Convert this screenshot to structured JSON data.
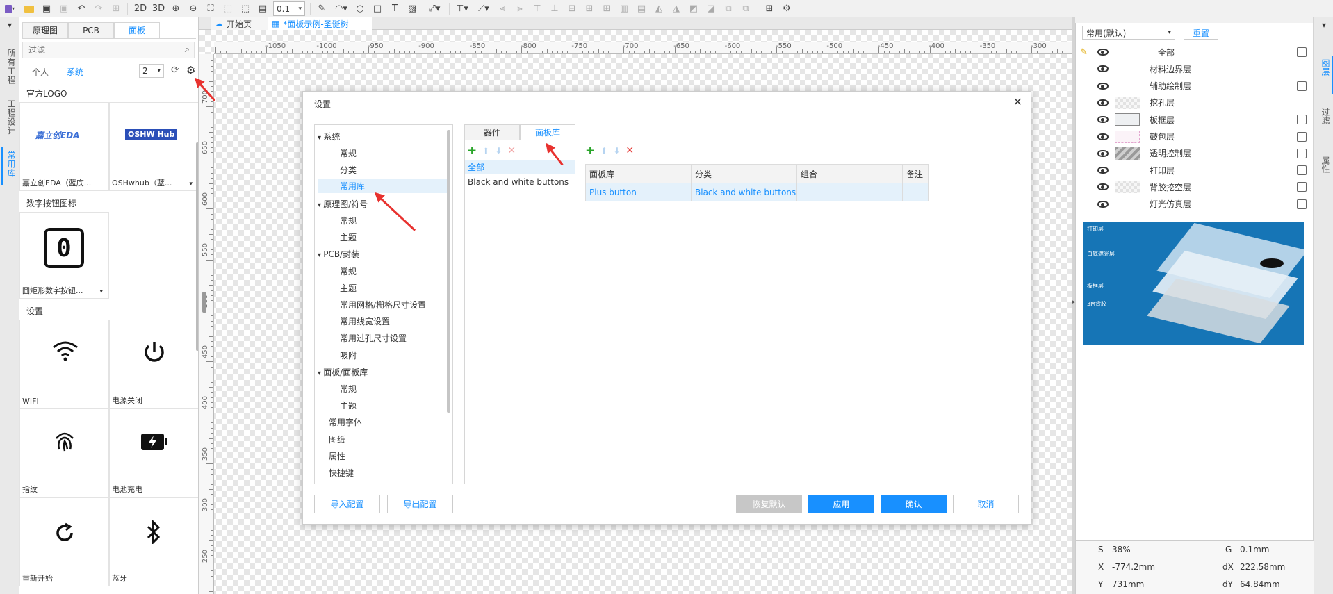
{
  "toolbar": {
    "view_2d": "2D",
    "view_3d": "3D",
    "zoom_value": "0.1"
  },
  "left_strip": {
    "tab_all_projects": "所有工程",
    "tab_project_design": "工程设计",
    "tab_common_library": "常用库"
  },
  "left_panel": {
    "tabs": [
      "原理图",
      "PCB",
      "面板"
    ],
    "filter_placeholder": "过滤",
    "scope_personal": "个人",
    "scope_system": "系统",
    "page_select": "2",
    "sections": [
      {
        "title": "官方LOGO",
        "items": [
          "嘉立创EDA（蓝底...",
          "OSHwhub（蓝..."
        ]
      },
      {
        "title": "数字按钮图标",
        "items": [
          "圆矩形数字按钮..."
        ]
      },
      {
        "title": "设置",
        "items": [
          "WIFI",
          "电源关闭",
          "指纹",
          "电池充电",
          "重新开始",
          "蓝牙"
        ]
      }
    ],
    "logo_text_1": "嘉立创EDA",
    "logo_text_2": "OSHW Hub"
  },
  "doc_tabs": [
    "开始页",
    "*面板示例-圣诞树"
  ],
  "ruler": {
    "h_labels": [
      "-1050",
      "-1000",
      "-950",
      "-900",
      "-850",
      "-800",
      "-750",
      "-700",
      "-650",
      "-600",
      "-550",
      "-500",
      "-450",
      "-400",
      "-350",
      "-300"
    ],
    "v_labels": [
      "700",
      "650",
      "600",
      "550",
      "500",
      "450",
      "400",
      "350",
      "300",
      "250"
    ]
  },
  "right_panel": {
    "preset_select": "常用(默认)",
    "reset_label": "重置",
    "layers": [
      "全部",
      "材料边界层",
      "辅助绘制层",
      "挖孔层",
      "板框层",
      "鼓包层",
      "透明控制层",
      "打印层",
      "背胶挖空层",
      "灯光仿真层"
    ],
    "preview_labels": [
      "打印层",
      "白底遮光层",
      "板框层",
      "3M背胶"
    ],
    "coords": {
      "s_label": "S",
      "s_value": "38%",
      "g_label": "G",
      "g_value": "0.1mm",
      "x_label": "X",
      "x_value": "-774.2mm",
      "dx_label": "dX",
      "dx_value": "222.58mm",
      "y_label": "Y",
      "y_value": "731mm",
      "dy_label": "dY",
      "dy_value": "64.84mm"
    }
  },
  "right_strip": {
    "tab_layers": "图层",
    "tab_filter": "过滤",
    "tab_properties": "属性"
  },
  "modal": {
    "title": "设置",
    "tree": [
      {
        "label": "系统",
        "level": 0,
        "expanded": true
      },
      {
        "label": "常规",
        "level": 1
      },
      {
        "label": "分类",
        "level": 1
      },
      {
        "label": "常用库",
        "level": 1,
        "selected": true
      },
      {
        "label": "原理图/符号",
        "level": 0,
        "expanded": true
      },
      {
        "label": "常规",
        "level": 1
      },
      {
        "label": "主题",
        "level": 1
      },
      {
        "label": "PCB/封装",
        "level": 0,
        "expanded": true
      },
      {
        "label": "常规",
        "level": 1
      },
      {
        "label": "主题",
        "level": 1
      },
      {
        "label": "常用网格/栅格尺寸设置",
        "level": 1
      },
      {
        "label": "常用线宽设置",
        "level": 1
      },
      {
        "label": "常用过孔尺寸设置",
        "level": 1
      },
      {
        "label": "吸附",
        "level": 1
      },
      {
        "label": "面板/面板库",
        "level": 0,
        "expanded": true
      },
      {
        "label": "常规",
        "level": 1
      },
      {
        "label": "主题",
        "level": 1
      },
      {
        "label": "常用字体",
        "level": 0
      },
      {
        "label": "图纸",
        "level": 0
      },
      {
        "label": "属性",
        "level": 0
      },
      {
        "label": "快捷键",
        "level": 0
      }
    ],
    "tabs": [
      "器件",
      "面板库"
    ],
    "category_list": [
      "全部",
      "Black and white buttons"
    ],
    "table_headers": [
      "面板库",
      "分类",
      "组合",
      "备注"
    ],
    "table_rows": [
      [
        "Plus button",
        "Black and white buttons",
        "",
        ""
      ]
    ],
    "buttons": {
      "import": "导入配置",
      "export": "导出配置",
      "restore": "恢复默认",
      "apply": "应用",
      "confirm": "确认",
      "cancel": "取消"
    }
  },
  "colors": {
    "accent": "#1890ff",
    "selected_bg": "#e4f1fb",
    "arrow": "#e8322f",
    "add_green": "#2aa52a",
    "delete_red": "#e53935"
  }
}
